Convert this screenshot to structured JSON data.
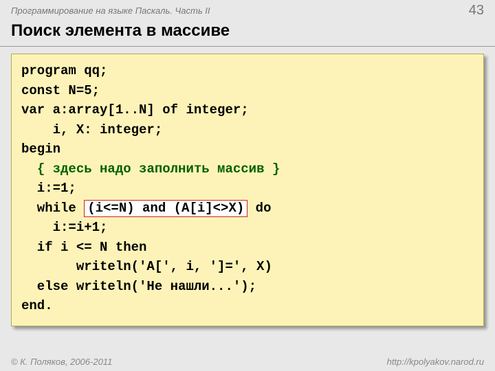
{
  "header": {
    "course": "Программирование на языке Паскаль. Часть II",
    "page": "43"
  },
  "title": "Поиск элемента в массиве",
  "code": {
    "l1": "program qq;",
    "l2": "const N=5;",
    "l3": "var a:array[1..N] of integer;",
    "l4": "    i, X: integer;",
    "l5": "begin",
    "l6_pre": "  ",
    "l6_comment": "{ здесь надо заполнить массив }",
    "l7": "  i:=1;",
    "l8_pre": "  while ",
    "l8_hl": "(i<=N) and (A[i]<>X)",
    "l8_post": " do",
    "l9": "    i:=i+1;",
    "l10": "  if i <= N then",
    "l11": "       writeln('A[', i, ']=', X)",
    "l12": "  else writeln('Не нашли...');",
    "l13": "end."
  },
  "footer": {
    "copyright": "© К. Поляков, 2006-2011",
    "url": "http://kpolyakov.narod.ru"
  }
}
